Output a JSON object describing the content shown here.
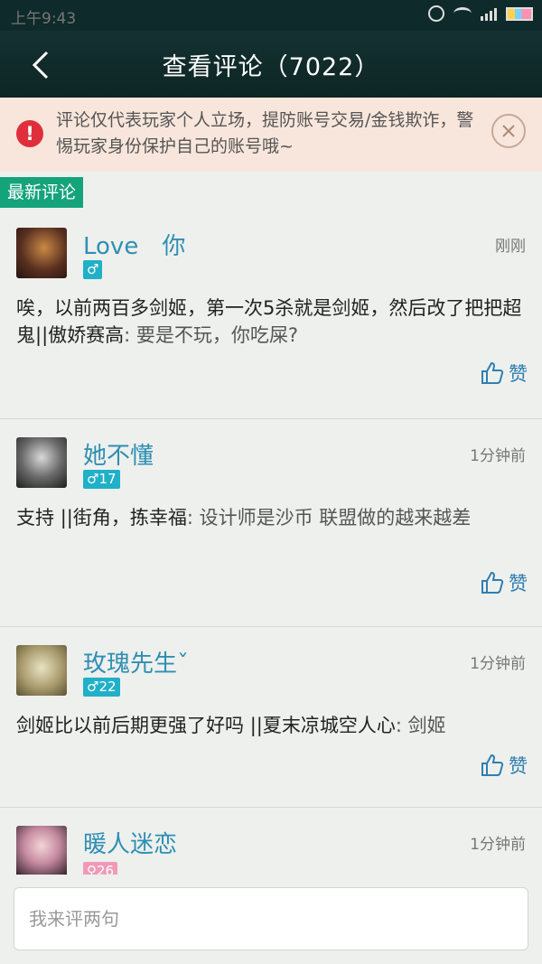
{
  "status_bar": {
    "time": "上午9:43",
    "icons": [
      "alarm-icon",
      "wifi-icon",
      "signal-icon",
      "battery-icon"
    ]
  },
  "header": {
    "back_icon": "back-arrow-icon",
    "title": "查看评论（7022）"
  },
  "notice": {
    "icon": "exclamation-icon",
    "text": "评论仅代表玩家个人立场，提防账号交易/金钱欺诈，警惕玩家身份保护自己的账号哦~",
    "close_icon": "close-icon"
  },
  "section_label": "最新评论",
  "comments": [
    {
      "username": "Love　你",
      "badge": "♂",
      "time": "刚刚",
      "text": "唉，以前两百多剑姬，第一次5杀就是剑姬，然后改了把把超鬼",
      "reply_author": "||傲娇赛高",
      "reply_text": ": 要是不玩，你吃屎?",
      "like_label": "赞"
    },
    {
      "username": "她不懂",
      "badge": "♂17",
      "time": "1分钟前",
      "text": "支持",
      "reply_author": "||街角，拣幸福",
      "reply_text": ": 设计师是沙币  联盟做的越来越差",
      "like_label": "赞"
    },
    {
      "username": "玫瑰先生ˇ",
      "badge": "♂22",
      "time": "1分钟前",
      "text": "剑姬比以前后期更强了好吗",
      "reply_author": "||夏末凉城空人心",
      "reply_text": ": 剑姬",
      "like_label": "赞"
    },
    {
      "username": "暖人迷恋",
      "badge": "♀26",
      "time": "1分钟前"
    }
  ],
  "input": {
    "placeholder": "我来评两句"
  },
  "colors": {
    "header_bg": "#0f2a2a",
    "notice_bg": "#f8e6dc",
    "accent_green": "#14a37b",
    "username_blue": "#2f8fb3",
    "badge_male": "#20b0c8",
    "badge_female": "#f09ab8"
  }
}
